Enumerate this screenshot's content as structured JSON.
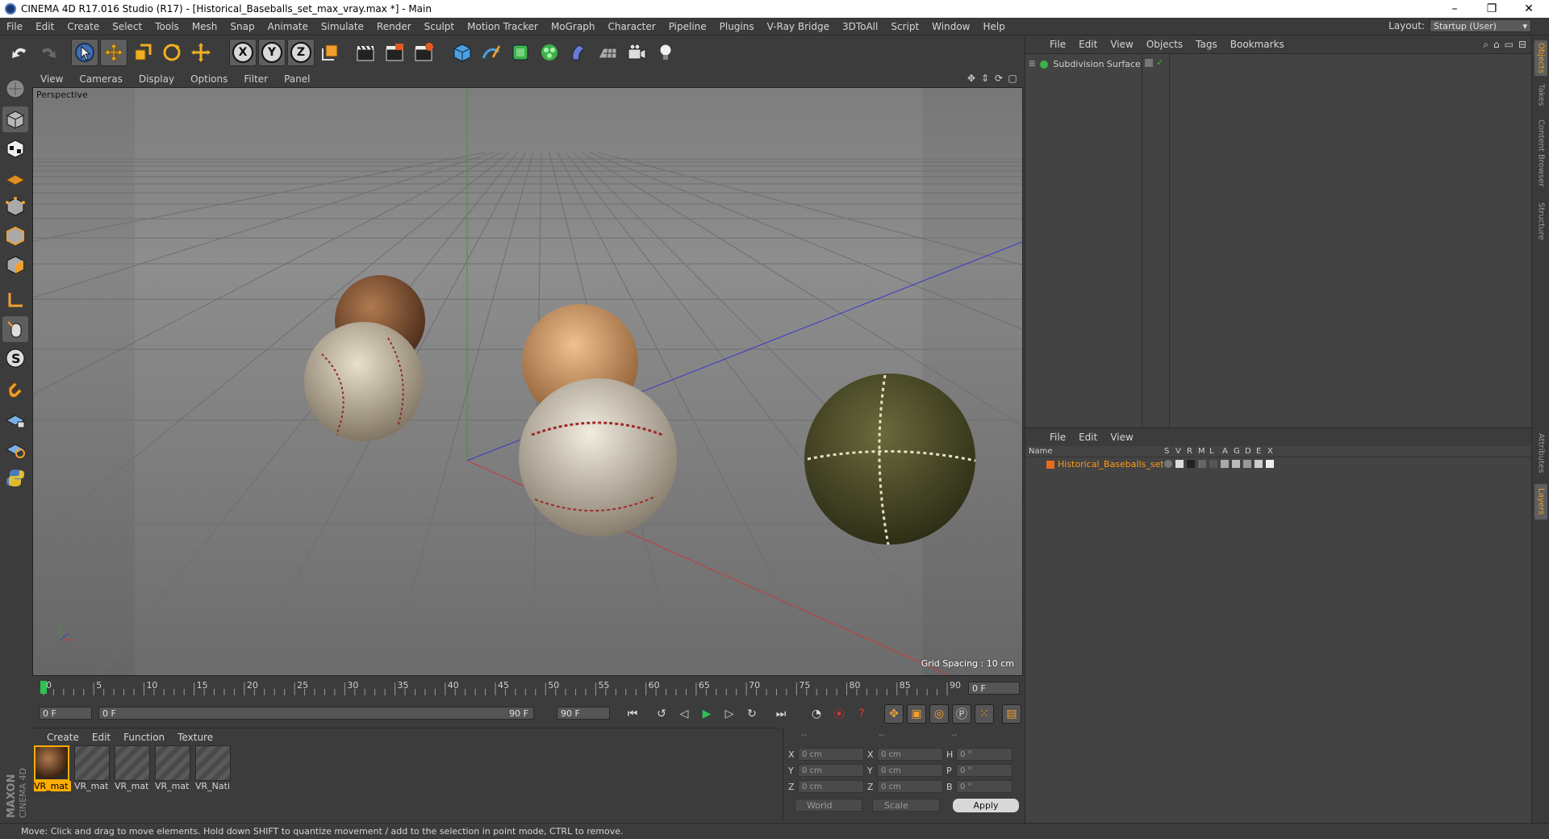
{
  "window": {
    "title": "CINEMA 4D R17.016 Studio (R17) - [Historical_Baseballs_set_max_vray.max *] - Main",
    "controls": [
      "–",
      "❐",
      "✕"
    ]
  },
  "menubar": {
    "items": [
      "File",
      "Edit",
      "Create",
      "Select",
      "Tools",
      "Mesh",
      "Snap",
      "Animate",
      "Simulate",
      "Render",
      "Sculpt",
      "Motion Tracker",
      "MoGraph",
      "Character",
      "Pipeline",
      "Plugins",
      "V-Ray Bridge",
      "3DToAll",
      "Script",
      "Window",
      "Help"
    ],
    "layout_label": "Layout:",
    "layout_value": "Startup (User)"
  },
  "toolbar": {
    "axes": [
      "X",
      "Y",
      "Z"
    ]
  },
  "viewport": {
    "menu": [
      "View",
      "Cameras",
      "Display",
      "Options",
      "Filter",
      "Panel"
    ],
    "camera_label": "Perspective",
    "grid_spacing": "Grid Spacing : 10 cm"
  },
  "timeline": {
    "ticks": [
      "0",
      "5",
      "10",
      "15",
      "20",
      "25",
      "30",
      "35",
      "40",
      "45",
      "50",
      "55",
      "60",
      "65",
      "70",
      "75",
      "80",
      "85",
      "90"
    ],
    "current_frame": "0 F",
    "start_frame": "0 F",
    "range_start": "0 F",
    "range_end": "90 F",
    "end_frame": "90 F"
  },
  "materials": {
    "menu": [
      "Create",
      "Edit",
      "Function",
      "Texture"
    ],
    "items": [
      "VR_mat",
      "VR_mat",
      "VR_mat",
      "VR_mat",
      "VR_Nati"
    ]
  },
  "coordinates": {
    "headers": [
      "--",
      "--",
      "--"
    ],
    "rows": [
      {
        "a": "X",
        "av": "0 cm",
        "b": "X",
        "bv": "0 cm",
        "c": "H",
        "cv": "0 °"
      },
      {
        "a": "Y",
        "av": "0 cm",
        "b": "Y",
        "bv": "0 cm",
        "c": "P",
        "cv": "0 °"
      },
      {
        "a": "Z",
        "av": "0 cm",
        "b": "Z",
        "bv": "0 cm",
        "c": "B",
        "cv": "0 °"
      }
    ],
    "mode": "World",
    "type": "Scale",
    "apply": "Apply"
  },
  "objects_panel": {
    "menu": [
      "File",
      "Edit",
      "View",
      "Objects",
      "Tags",
      "Bookmarks"
    ],
    "object": "Subdivision Surface"
  },
  "layers_panel": {
    "menu": [
      "File",
      "Edit",
      "View"
    ],
    "name_header": "Name",
    "flags": [
      "S",
      "V",
      "R",
      "M",
      "L",
      "A",
      "G",
      "D",
      "E",
      "X"
    ],
    "layer": "Historical_Baseballs_set"
  },
  "right_tabs": [
    "Objects",
    "Takes",
    "Content Browser",
    "Structure",
    "Attributes",
    "Layers"
  ],
  "status": "Move: Click and drag to move elements. Hold down SHIFT to quantize movement / add to the selection in point mode, CTRL to remove.",
  "logo": {
    "brand": "MAXON",
    "product": "CINEMA 4D"
  }
}
